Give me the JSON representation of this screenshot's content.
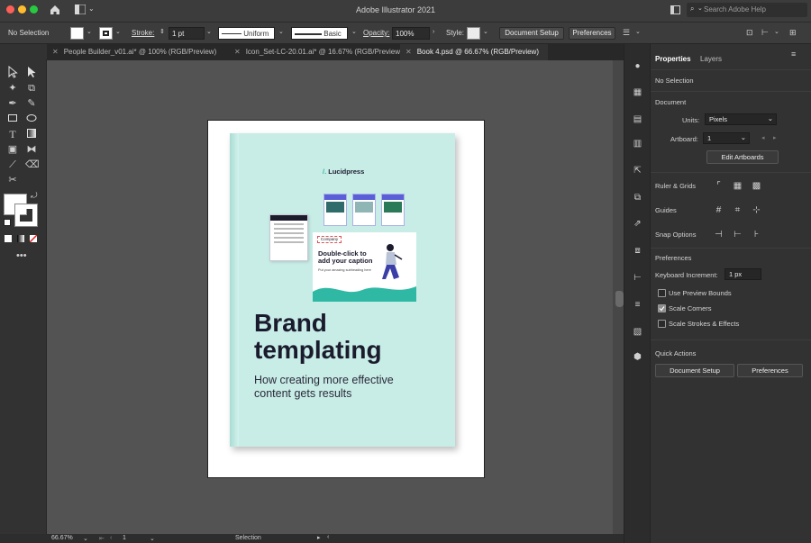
{
  "app": {
    "title": "Adobe Illustrator 2021",
    "search_placeholder": "Search Adobe Help"
  },
  "control_bar": {
    "selection": "No Selection",
    "stroke_label": "Stroke:",
    "stroke_value": "1 pt",
    "profile_uniform": "Uniform",
    "brush_basic": "Basic",
    "opacity_label": "Opacity:",
    "opacity_value": "100%",
    "style_label": "Style:",
    "document_setup": "Document Setup",
    "preferences": "Preferences"
  },
  "tabs": [
    {
      "label": "People Builder_v01.ai* @ 100% (RGB/Preview)",
      "active": false
    },
    {
      "label": "Icon_Set-LC-20.01.ai* @ 16.67% (RGB/Preview)",
      "active": false
    },
    {
      "label": "Book 4.psd @ 66.67% (RGB/Preview)",
      "active": true
    }
  ],
  "book": {
    "brand": "Lucidpress",
    "title_line1": "Brand",
    "title_line2": "templating",
    "subtitle_line1": "How creating more effective",
    "subtitle_line2": "content gets results",
    "caption_line1": "Double-click to",
    "caption_line2": "add your caption",
    "caption_sub": "Put your amazing subheading here",
    "company_tag": "Company",
    "colors": {
      "cover": "#c8ece6",
      "accent": "#2fb9a5",
      "dark": "#1b1b2e"
    }
  },
  "status": {
    "zoom": "66.67%",
    "artboard": "1",
    "tool": "Selection"
  },
  "panel": {
    "tab_properties": "Properties",
    "tab_layers": "Layers",
    "no_selection": "No Selection",
    "document_heading": "Document",
    "units_label": "Units:",
    "units_value": "Pixels",
    "artboard_label": "Artboard:",
    "artboard_value": "1",
    "edit_artboards": "Edit Artboards",
    "ruler_grids": "Ruler & Grids",
    "guides": "Guides",
    "snap_options": "Snap Options",
    "preferences_heading": "Preferences",
    "keyboard_increment_label": "Keyboard Increment:",
    "keyboard_increment_value": "1 px",
    "use_preview_bounds": "Use Preview Bounds",
    "scale_corners": "Scale Corners",
    "scale_strokes": "Scale Strokes & Effects",
    "checkbox_states": {
      "use_preview_bounds": false,
      "scale_corners": true,
      "scale_strokes": false
    },
    "quick_actions": "Quick Actions",
    "qa_document_setup": "Document Setup",
    "qa_preferences": "Preferences"
  },
  "colors": {
    "chrome": "#3c3c3c",
    "panel": "#323232",
    "canvas": "#535353"
  }
}
